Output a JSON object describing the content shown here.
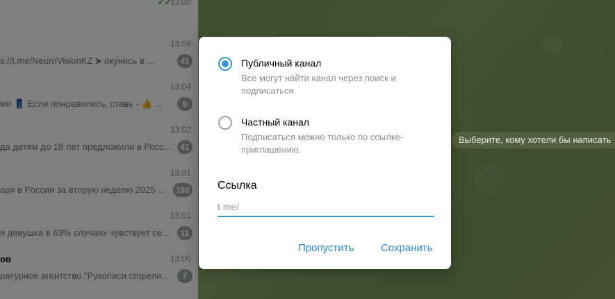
{
  "chat_list": {
    "rows": [
      {
        "time": "13:00",
        "name": "",
        "preview": "",
        "badge": ""
      },
      {
        "time": "13:06",
        "name": "",
        "preview": "s://t.me/NeuroVisionKZ ⮞ окунись в ...",
        "badge": "41"
      },
      {
        "time": "13:04",
        "name": "",
        "preview": "ми 👖 Если понравились, ставь - 👍 ...",
        "badge": "9"
      },
      {
        "time": "13:02",
        "name": "",
        "preview": "да детям до 18 лет предложили в Росс...",
        "badge": "41"
      },
      {
        "time": "13:01",
        "name": "",
        "preview": "аря в России за вторую неделю 2025 ...",
        "badge": "198"
      },
      {
        "time": "13:01",
        "name": "",
        "preview": "я девушка в 63% случаях чувствует се...",
        "badge": "11"
      },
      {
        "time": "13:00",
        "name": "ов",
        "preview": "ратурное агентство \"Рукописи сгорели...",
        "badge": "7"
      }
    ]
  },
  "chat_area": {
    "select_chat_hint": "Выберите, кому хотели бы написать"
  },
  "modal": {
    "options": [
      {
        "title": "Публичный канал",
        "description": "Все могут найти канал через поиск и подписаться",
        "checked": true
      },
      {
        "title": "Частный канал",
        "description": "Подписаться можно только по ссылке-приглашению.",
        "checked": false
      }
    ],
    "link_label": "Ссылка",
    "link_value": "",
    "link_placeholder": "t.me/",
    "skip_label": "Пропустить",
    "save_label": "Сохранить"
  },
  "colors": {
    "accent": "#3a95d6",
    "link_button": "#2b87c9",
    "badge": "#a0a6ab"
  }
}
